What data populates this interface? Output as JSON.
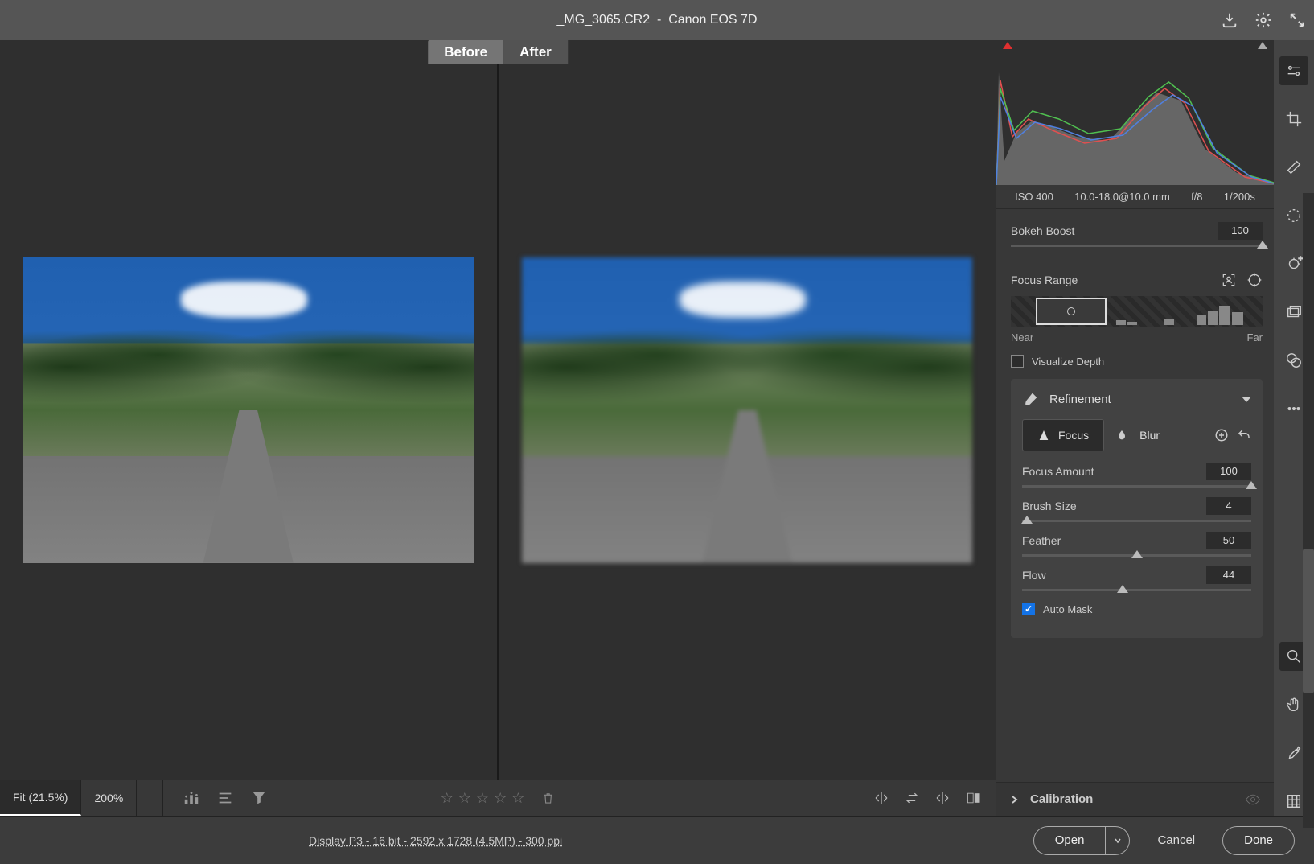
{
  "title": {
    "filename": "_MG_3065.CR2",
    "camera": "Canon EOS 7D"
  },
  "compare": {
    "before": "Before",
    "after": "After"
  },
  "histogram_meta": {
    "iso": "ISO 400",
    "lens": "10.0-18.0@10.0 mm",
    "aperture": "f/8",
    "shutter": "1/200s"
  },
  "sliders": {
    "bokeh_boost": {
      "label": "Bokeh Boost",
      "value": "100",
      "pct": 100
    },
    "focus_range": {
      "label": "Focus Range",
      "near": "Near",
      "far": "Far"
    },
    "visualize_depth": {
      "label": "Visualize Depth",
      "checked": false
    },
    "refinement": {
      "title": "Refinement"
    },
    "focus_btn": "Focus",
    "blur_btn": "Blur",
    "focus_amount": {
      "label": "Focus Amount",
      "value": "100",
      "pct": 100
    },
    "brush_size": {
      "label": "Brush Size",
      "value": "4",
      "pct": 2
    },
    "feather": {
      "label": "Feather",
      "value": "50",
      "pct": 50
    },
    "flow": {
      "label": "Flow",
      "value": "44",
      "pct": 44
    },
    "auto_mask": {
      "label": "Auto Mask",
      "checked": true
    }
  },
  "sections": {
    "calibration": "Calibration"
  },
  "footer": {
    "fit": "Fit (21.5%)",
    "zoom200": "200%",
    "display_info": "Display P3 - 16 bit - 2592 x 1728 (4.5MP) - 300 ppi",
    "open": "Open",
    "cancel": "Cancel",
    "done": "Done"
  }
}
